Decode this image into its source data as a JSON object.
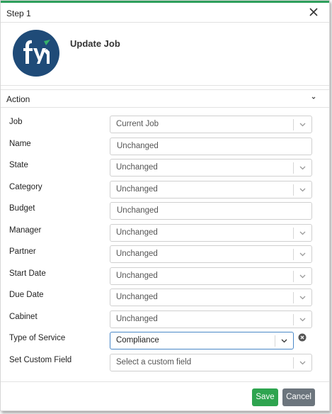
{
  "dialog": {
    "title": "Step 1",
    "heading": "Update Job",
    "section_title": "Action"
  },
  "fields": [
    {
      "label": "Job",
      "value": "Current Job",
      "type": "select",
      "placeholder": false
    },
    {
      "label": "Name",
      "value": "Unchanged",
      "type": "text",
      "placeholder": true
    },
    {
      "label": "State",
      "value": "Unchanged",
      "type": "select",
      "placeholder": true
    },
    {
      "label": "Category",
      "value": "Unchanged",
      "type": "select",
      "placeholder": true
    },
    {
      "label": "Budget",
      "value": "Unchanged",
      "type": "text",
      "placeholder": true
    },
    {
      "label": "Manager",
      "value": "Unchanged",
      "type": "select",
      "placeholder": true
    },
    {
      "label": "Partner",
      "value": "Unchanged",
      "type": "select",
      "placeholder": true
    },
    {
      "label": "Start Date",
      "value": "Unchanged",
      "type": "select",
      "placeholder": true
    },
    {
      "label": "Due Date",
      "value": "Unchanged",
      "type": "select",
      "placeholder": true
    },
    {
      "label": "Cabinet",
      "value": "Unchanged",
      "type": "select",
      "placeholder": true
    },
    {
      "label": "Type of Service",
      "value": "Compliance",
      "type": "select",
      "placeholder": false
    },
    {
      "label": "Set Custom Field",
      "value": "Select a custom field",
      "type": "select",
      "placeholder": true
    }
  ],
  "buttons": {
    "save": "Save",
    "cancel": "Cancel"
  },
  "colors": {
    "accent": "#2e9f5c",
    "save": "#2ea44f",
    "cancel": "#6c757d",
    "logo_bg": "#1f4b78",
    "active_border": "#4a88c7"
  },
  "icons": {
    "close": "close-icon",
    "section": "chevron-down-icon",
    "select": "chevron-down-icon",
    "clear": "clear-icon",
    "logo": "fyi-logo"
  }
}
